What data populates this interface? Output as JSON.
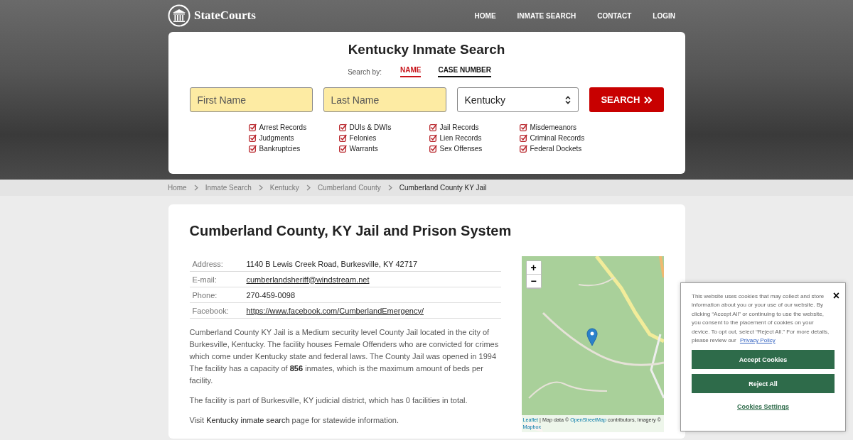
{
  "header": {
    "logo": "StateCourts",
    "nav": [
      {
        "label": "HOME"
      },
      {
        "label": "INMATE SEARCH"
      },
      {
        "label": "CONTACT"
      },
      {
        "label": "LOGIN"
      }
    ]
  },
  "search": {
    "title": "Kentucky Inmate Search",
    "search_by_label": "Search by:",
    "tabs": [
      {
        "label": "NAME",
        "selected": true
      },
      {
        "label": "CASE NUMBER",
        "selected": false
      }
    ],
    "first_name": {
      "placeholder": "First Name"
    },
    "last_name": {
      "placeholder": "Last Name"
    },
    "state": {
      "value": "Kentucky"
    },
    "button": "SEARCH",
    "record_types": [
      {
        "label": "Arrest Records",
        "checked": true
      },
      {
        "label": "Judgments",
        "checked": true
      },
      {
        "label": "Bankruptcies",
        "checked": true
      },
      {
        "label": "DUIs & DWIs",
        "checked": true
      },
      {
        "label": "Felonies",
        "checked": true
      },
      {
        "label": "Warrants",
        "checked": true
      },
      {
        "label": "Jail Records",
        "checked": true
      },
      {
        "label": "Lien Records",
        "checked": true
      },
      {
        "label": "Sex Offenses",
        "checked": true
      },
      {
        "label": "Misdemeanors",
        "checked": true
      },
      {
        "label": "Criminal Records",
        "checked": true
      },
      {
        "label": "Federal Dockets",
        "checked": true
      }
    ]
  },
  "breadcrumb": [
    {
      "label": "Home",
      "current": false
    },
    {
      "label": "Inmate Search",
      "current": false
    },
    {
      "label": "Kentucky",
      "current": false
    },
    {
      "label": "Cumberland County",
      "current": false
    },
    {
      "label": "Cumberland County KY Jail",
      "current": true
    }
  ],
  "facility": {
    "title": "Cumberland County, KY Jail and Prison System",
    "details": [
      {
        "label": "Address:",
        "value": "1140 B Lewis Creek Road, Burkesville, KY 42717",
        "link": false
      },
      {
        "label": "E-mail:",
        "value": "cumberlandsheriff@windstream.net",
        "link": true
      },
      {
        "label": "Phone:",
        "value": "270-459-0098",
        "link": false
      },
      {
        "label": "Facebook:",
        "value": "https://www.facebook.com/CumberlandEmergency/",
        "link": true
      }
    ],
    "paragraphs": [
      {
        "text": "Cumberland County KY Jail is a Medium security level County Jail located in the city of Burkesville, Kentucky. The facility houses Female Offenders who are convicted for crimes which come under Kentucky state and federal laws. The County Jail was opened in 1994 The facility has a capacity of **856** inmates, which is the maximum amount of beds per facility."
      },
      {
        "text": "The facility is part of Burkesville, KY judicial district, which has 0 facilities in total."
      },
      {
        "text": "Visit ",
        "link": "Kentucky inmate search",
        "after": " page for statewide information."
      }
    ],
    "map": {
      "zoom_in": "+",
      "zoom_out": "−",
      "attribution": [
        {
          "text": "Leaflet",
          "link": true
        },
        {
          "text": " | Map data © ",
          "link": false
        },
        {
          "text": "OpenStreetMap",
          "link": true
        },
        {
          "text": " contributors, Imagery © ",
          "link": false
        },
        {
          "text": "Mapbox",
          "link": true
        }
      ]
    }
  },
  "cookie_banner": {
    "text": "This website uses cookies that may collect and store information about you or your use of our website. By clicking “Accept All” or continuing to use the website, you consent to the placement of cookies on your device. To opt out, select “Reject All.” For more details, please review our ",
    "link": "Privacy Policy",
    "close": "×",
    "accept": "Accept Cookies",
    "reject": "Reject All",
    "settings": "Cookies Settings"
  }
}
